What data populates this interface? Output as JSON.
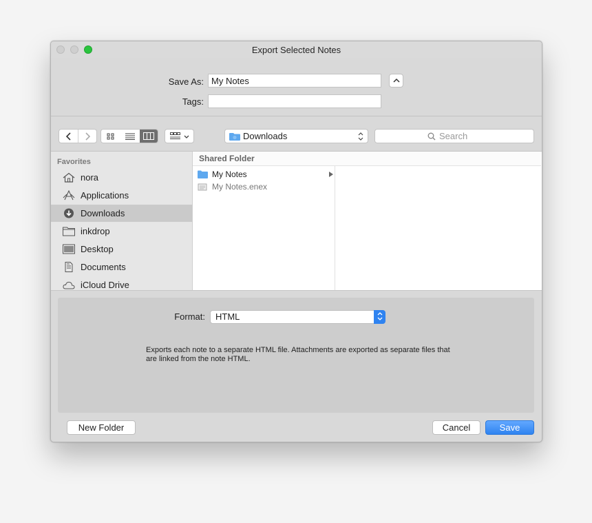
{
  "window": {
    "title": "Export Selected Notes"
  },
  "save_as": {
    "label": "Save As:",
    "value": "My Notes"
  },
  "tags": {
    "label": "Tags:",
    "value": ""
  },
  "toolbar": {
    "location": "Downloads",
    "search_placeholder": "Search"
  },
  "sidebar": {
    "heading": "Favorites",
    "items": [
      {
        "label": "nora",
        "icon": "home-icon"
      },
      {
        "label": "Applications",
        "icon": "applications-icon"
      },
      {
        "label": "Downloads",
        "icon": "downloads-icon",
        "selected": true
      },
      {
        "label": "inkdrop",
        "icon": "folder-icon"
      },
      {
        "label": "Desktop",
        "icon": "desktop-icon"
      },
      {
        "label": "Documents",
        "icon": "documents-icon"
      },
      {
        "label": "iCloud Drive",
        "icon": "cloud-icon"
      }
    ]
  },
  "browser": {
    "column_header": "Shared Folder",
    "rows": [
      {
        "label": "My Notes",
        "kind": "folder"
      },
      {
        "label": "My Notes.enex",
        "kind": "file"
      }
    ]
  },
  "format": {
    "label": "Format:",
    "value": "HTML",
    "description": "Exports each note to a separate HTML file.  Attachments are exported as separate files that are linked from the note HTML."
  },
  "buttons": {
    "new_folder": "New Folder",
    "cancel": "Cancel",
    "save": "Save"
  },
  "colors": {
    "accent": "#2f83f0",
    "traffic_green": "#2ac43e"
  }
}
